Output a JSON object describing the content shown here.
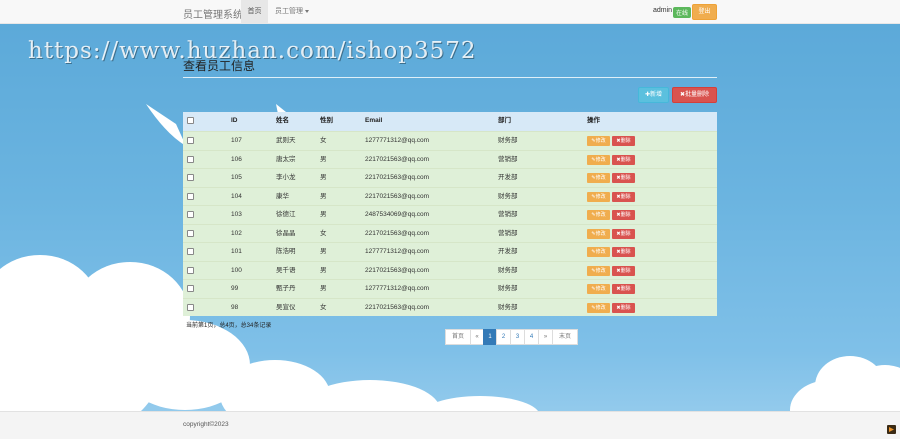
{
  "navbar": {
    "brand": "员工管理系统",
    "home": "首页",
    "employee_menu": "员工管理",
    "user": "admin",
    "status_badge": "在线",
    "logout": "登出"
  },
  "watermark": "https://www.huzhan.com/ishop3572",
  "page": {
    "title": "查看员工信息",
    "add_button": "新增",
    "batch_delete_button": "批量删除"
  },
  "table": {
    "headers": [
      "ID",
      "姓名",
      "性别",
      "Email",
      "部门",
      "操作"
    ],
    "edit_label": "修改",
    "delete_label": "删除",
    "rows": [
      {
        "id": "107",
        "name": "武则天",
        "gender": "女",
        "email": "1277771312@qq.com",
        "dept": "财务部"
      },
      {
        "id": "106",
        "name": "唐太宗",
        "gender": "男",
        "email": "2217021563@qq.com",
        "dept": "营销部"
      },
      {
        "id": "105",
        "name": "李小龙",
        "gender": "男",
        "email": "2217021563@qq.com",
        "dept": "开发部"
      },
      {
        "id": "104",
        "name": "康华",
        "gender": "男",
        "email": "2217021563@qq.com",
        "dept": "财务部"
      },
      {
        "id": "103",
        "name": "徐德江",
        "gender": "男",
        "email": "2487534069@qq.com",
        "dept": "营销部"
      },
      {
        "id": "102",
        "name": "徐晶晶",
        "gender": "女",
        "email": "2217021563@qq.com",
        "dept": "营销部"
      },
      {
        "id": "101",
        "name": "陈浩明",
        "gender": "男",
        "email": "1277771312@qq.com",
        "dept": "开发部"
      },
      {
        "id": "100",
        "name": "吴千语",
        "gender": "男",
        "email": "2217021563@qq.com",
        "dept": "财务部"
      },
      {
        "id": "99",
        "name": "甄子丹",
        "gender": "男",
        "email": "1277771312@qq.com",
        "dept": "财务部"
      },
      {
        "id": "98",
        "name": "吴宣仪",
        "gender": "女",
        "email": "2217021563@qq.com",
        "dept": "财务部"
      }
    ]
  },
  "page_info": "当前第1页，总4页，总34条记录",
  "pagination": {
    "first": "首页",
    "prev": "«",
    "pages": [
      "1",
      "2",
      "3",
      "4"
    ],
    "active_page": "1",
    "next": "»",
    "last": "末页"
  },
  "footer": {
    "copyright": "copyright©2023"
  },
  "colors": {
    "sky": "#6bb4e0",
    "primary": "#337ab7",
    "success": "#5cb85c",
    "warning": "#f0ad4e",
    "danger": "#d9534f",
    "info": "#5bc0de",
    "row_bg": "#dff0d8",
    "header_bg": "#d7e9f7"
  },
  "icons": {
    "add": "plus-icon",
    "batch_delete": "x-icon",
    "edit": "pencil-icon",
    "delete": "x-icon"
  }
}
